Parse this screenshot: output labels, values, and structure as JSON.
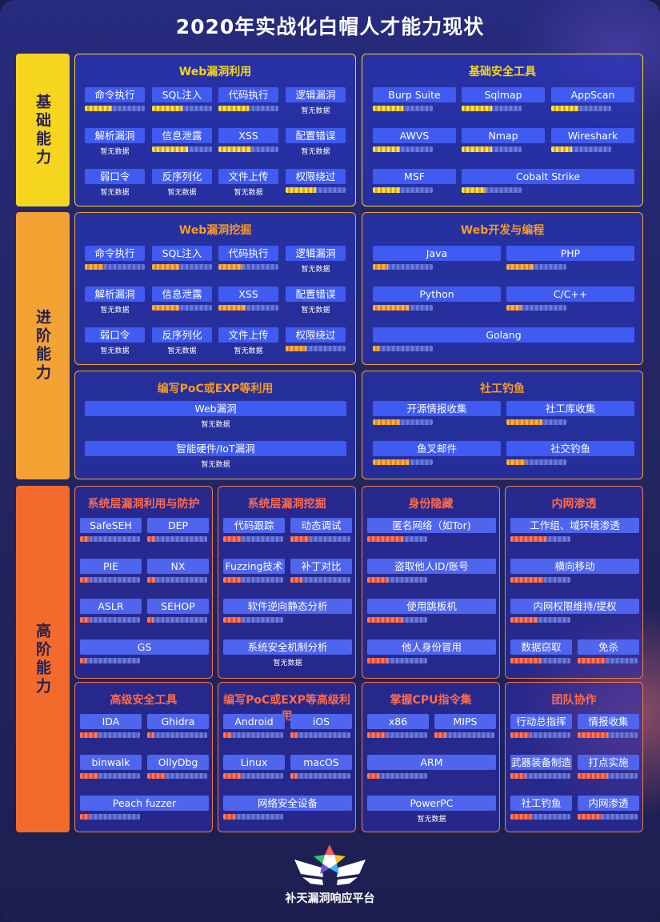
{
  "title": "2020年实战化白帽人才能力现状",
  "nodata_text": "暂无数据",
  "categories": {
    "basic": "基础能力",
    "advanced": "进阶能力",
    "high": "高阶能力"
  },
  "colors": {
    "basic": "#f5d51e",
    "advanced": "#f3a234",
    "high": "#f07a4a",
    "chip": "#3f5bf2"
  },
  "panels": {
    "web_exploit": {
      "title": "Web漏洞利用",
      "items": [
        {
          "label": "命令执行",
          "level": 0.45
        },
        {
          "label": "SQL注入",
          "level": 0.5
        },
        {
          "label": "代码执行",
          "level": 0.5
        },
        {
          "label": "逻辑漏洞",
          "level": null
        },
        {
          "label": "解析漏洞",
          "level": null
        },
        {
          "label": "信息泄露",
          "level": 0.6
        },
        {
          "label": "XSS",
          "level": 0.55
        },
        {
          "label": "配置错误",
          "level": null
        },
        {
          "label": "弱口令",
          "level": null
        },
        {
          "label": "反序列化",
          "level": null
        },
        {
          "label": "文件上传",
          "level": null
        },
        {
          "label": "权限绕过",
          "level": 0.5
        }
      ]
    },
    "basic_tools": {
      "title": "基础安全工具",
      "items": [
        {
          "label": "Burp Suite",
          "level": 0.5
        },
        {
          "label": "Sqlmap",
          "level": 0.5
        },
        {
          "label": "AppScan",
          "level": 0.45
        },
        {
          "label": "AWVS",
          "level": 0.45
        },
        {
          "label": "Nmap",
          "level": 0.5
        },
        {
          "label": "Wireshark",
          "level": 0.35
        },
        {
          "label": "MSF",
          "level": 0.45
        },
        {
          "label": "Cobalt Strike",
          "level": 0.4
        }
      ]
    },
    "web_mining": {
      "title": "Web漏洞挖掘",
      "items": [
        {
          "label": "命令执行",
          "level": 0.3
        },
        {
          "label": "SQL注入",
          "level": 0.45
        },
        {
          "label": "代码执行",
          "level": 0.4
        },
        {
          "label": "逻辑漏洞",
          "level": null
        },
        {
          "label": "解析漏洞",
          "level": null
        },
        {
          "label": "信息泄露",
          "level": 0.45
        },
        {
          "label": "XSS",
          "level": 0.45
        },
        {
          "label": "配置错误",
          "level": null
        },
        {
          "label": "弱口令",
          "level": null
        },
        {
          "label": "反序列化",
          "level": null
        },
        {
          "label": "文件上传",
          "level": null
        },
        {
          "label": "权限绕过",
          "level": 0.35
        }
      ]
    },
    "web_dev": {
      "title": "Web开发与编程",
      "items": [
        {
          "label": "Java",
          "level": 0.25
        },
        {
          "label": "PHP",
          "level": 0.45
        },
        {
          "label": "Python",
          "level": 0.6
        },
        {
          "label": "C/C++",
          "level": 0.25
        },
        {
          "label": "Golang",
          "level": 0.1
        }
      ]
    },
    "poc_exp": {
      "title": "编写PoC或EXP等利用",
      "items": [
        {
          "label": "Web漏洞",
          "level": null
        },
        {
          "label": "智能硬件/IoT漏洞",
          "level": null
        }
      ]
    },
    "phishing": {
      "title": "社工钓鱼",
      "items": [
        {
          "label": "开源情报收集",
          "level": 0.45
        },
        {
          "label": "社工库收集",
          "level": 0.6
        },
        {
          "label": "鱼叉邮件",
          "level": 0.6
        },
        {
          "label": "社交钓鱼",
          "level": 0.3
        }
      ]
    },
    "sys_exploit": {
      "title": "系统层漏洞利用与防护",
      "items": [
        {
          "label": "SafeSEH",
          "level": 0.15
        },
        {
          "label": "DEP",
          "level": 0.15
        },
        {
          "label": "PIE",
          "level": 0.15
        },
        {
          "label": "NX",
          "level": 0.15
        },
        {
          "label": "ASLR",
          "level": 0.15
        },
        {
          "label": "SEHOP",
          "level": 0.1
        },
        {
          "label": "GS",
          "level": 0.1
        }
      ]
    },
    "sys_mining": {
      "title": "系统层漏洞挖掘",
      "items": [
        {
          "label": "代码跟踪",
          "level": 0.3
        },
        {
          "label": "动态调试",
          "level": 0.3
        },
        {
          "label": "Fuzzing技术",
          "level": 0.3
        },
        {
          "label": "补丁对比",
          "level": 0.2
        },
        {
          "label": "软件逆向静态分析",
          "level": 0.3
        },
        {
          "label": "系统安全机制分析",
          "level": null
        }
      ]
    },
    "identity": {
      "title": "身份隐藏",
      "items": [
        {
          "label": "匿名网络（如Tor)",
          "level": 0.6
        },
        {
          "label": "盗取他人ID/账号",
          "level": 0.35
        },
        {
          "label": "使用跳板机",
          "level": 0.6
        },
        {
          "label": "他人身份冒用",
          "level": 0.35
        }
      ]
    },
    "intranet": {
      "title": "内网渗透",
      "items": [
        {
          "label": "工作组、域环境渗透",
          "level": 0.6
        },
        {
          "label": "横向移动",
          "level": 0.55
        },
        {
          "label": "内网权限维持/提权",
          "level": 0.45
        },
        {
          "label": "数据窃取",
          "level": 0.5
        },
        {
          "label": "免杀",
          "level": 0.45
        }
      ]
    },
    "adv_tools": {
      "title": "高级安全工具",
      "items": [
        {
          "label": "IDA",
          "level": 0.3
        },
        {
          "label": "Ghidra",
          "level": 0.1
        },
        {
          "label": "binwalk",
          "level": 0.3
        },
        {
          "label": "OllyDbg",
          "level": 0.3
        },
        {
          "label": "Peach fuzzer",
          "level": 0.15
        }
      ]
    },
    "poc_adv": {
      "title": "编写PoC或EXP等高级利用",
      "items": [
        {
          "label": "Android",
          "level": 0.15
        },
        {
          "label": "iOS",
          "level": 0.1
        },
        {
          "label": "Linux",
          "level": 0.3
        },
        {
          "label": "macOS",
          "level": 0.1
        },
        {
          "label": "网络安全设备",
          "level": 0.2
        }
      ]
    },
    "cpu": {
      "title": "掌握CPU指令集",
      "items": [
        {
          "label": "x86",
          "level": 0.3
        },
        {
          "label": "MIPS",
          "level": 0.2
        },
        {
          "label": "ARM",
          "level": 0.2
        },
        {
          "label": "PowerPC",
          "level": null
        }
      ]
    },
    "team": {
      "title": "团队协作",
      "items": [
        {
          "label": "行动总指挥",
          "level": 0.3
        },
        {
          "label": "情报收集",
          "level": 0.5
        },
        {
          "label": "武器装备制造",
          "level": 0.25
        },
        {
          "label": "打点实施",
          "level": 0.5
        },
        {
          "label": "社工钓鱼",
          "level": 0.35
        },
        {
          "label": "内网渗透",
          "level": 0.4
        }
      ]
    }
  },
  "footer": {
    "logo_text": "补天漏洞响应平台"
  }
}
